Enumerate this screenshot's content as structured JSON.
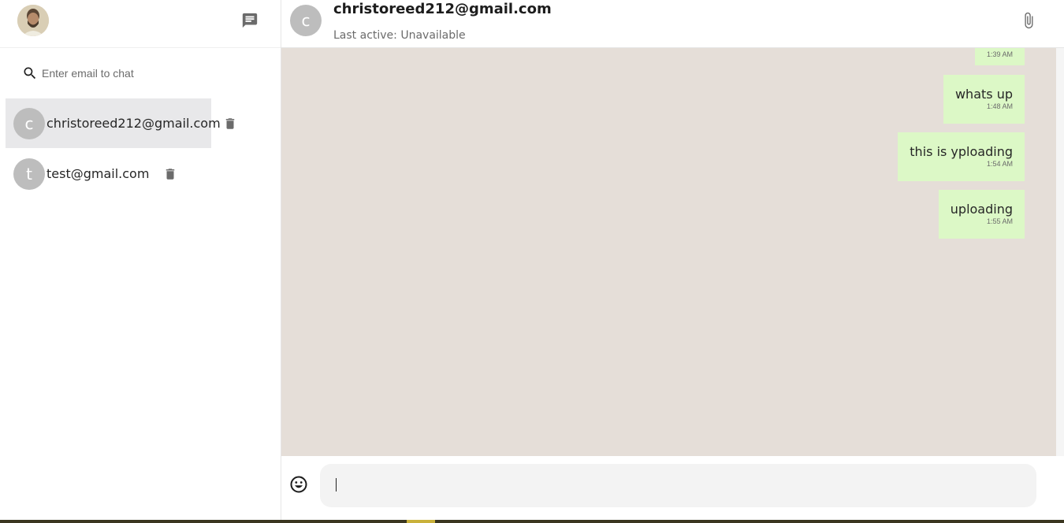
{
  "sidebar": {
    "user_avatar_icon": "user-photo",
    "new_chat_icon": "chat-icon",
    "search": {
      "icon": "search-icon",
      "placeholder": "Enter email to chat",
      "value": ""
    },
    "chats": [
      {
        "initial": "c",
        "email": "christoreed212@gmail.com",
        "active": true,
        "delete_icon": "trash-icon"
      },
      {
        "initial": "t",
        "email": "test@gmail.com",
        "active": false,
        "delete_icon": "trash-icon"
      }
    ]
  },
  "header": {
    "initial": "c",
    "title": "christoreed212@gmail.com",
    "subtitle": "Last active: Unavailable",
    "attach_icon": "paperclip-icon"
  },
  "messages": [
    {
      "text": "",
      "time": "1:39 AM"
    },
    {
      "text": "whats up",
      "time": "1:48 AM"
    },
    {
      "text": "this is yploading",
      "time": "1:54 AM"
    },
    {
      "text": "uploading",
      "time": "1:55 AM"
    }
  ],
  "composer": {
    "emoji_icon": "smiley-icon",
    "value": "",
    "placeholder": ""
  },
  "colors": {
    "chat_background": "#e5ded8",
    "outgoing_bubble": "#dcf8c6",
    "avatar_placeholder": "#bdbdbd",
    "active_chat": "#e8e8ea",
    "icon_gray": "#6b6b6b"
  }
}
